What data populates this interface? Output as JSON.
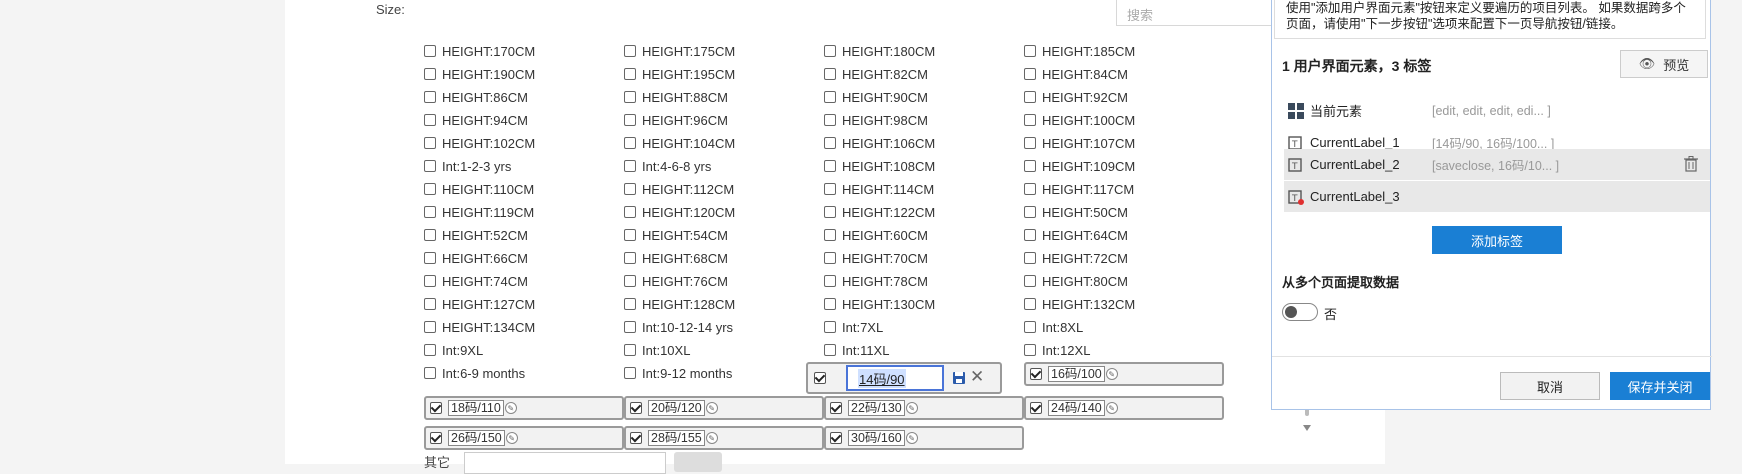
{
  "form": {
    "size_label": "Size:",
    "search_placeholder": "搜索",
    "options": [
      {
        "label": "HEIGHT:170CM",
        "checked": false
      },
      {
        "label": "HEIGHT:175CM",
        "checked": false
      },
      {
        "label": "HEIGHT:180CM",
        "checked": false
      },
      {
        "label": "HEIGHT:185CM",
        "checked": false
      },
      {
        "label": "HEIGHT:190CM",
        "checked": false
      },
      {
        "label": "HEIGHT:195CM",
        "checked": false
      },
      {
        "label": "HEIGHT:82CM",
        "checked": false
      },
      {
        "label": "HEIGHT:84CM",
        "checked": false
      },
      {
        "label": "HEIGHT:86CM",
        "checked": false
      },
      {
        "label": "HEIGHT:88CM",
        "checked": false
      },
      {
        "label": "HEIGHT:90CM",
        "checked": false
      },
      {
        "label": "HEIGHT:92CM",
        "checked": false
      },
      {
        "label": "HEIGHT:94CM",
        "checked": false
      },
      {
        "label": "HEIGHT:96CM",
        "checked": false
      },
      {
        "label": "HEIGHT:98CM",
        "checked": false
      },
      {
        "label": "HEIGHT:100CM",
        "checked": false
      },
      {
        "label": "HEIGHT:102CM",
        "checked": false
      },
      {
        "label": "HEIGHT:104CM",
        "checked": false
      },
      {
        "label": "HEIGHT:106CM",
        "checked": false
      },
      {
        "label": "HEIGHT:107CM",
        "checked": false
      },
      {
        "label": "Int:1-2-3 yrs",
        "checked": false
      },
      {
        "label": "Int:4-6-8 yrs",
        "checked": false
      },
      {
        "label": "HEIGHT:108CM",
        "checked": false
      },
      {
        "label": "HEIGHT:109CM",
        "checked": false
      },
      {
        "label": "HEIGHT:110CM",
        "checked": false
      },
      {
        "label": "HEIGHT:112CM",
        "checked": false
      },
      {
        "label": "HEIGHT:114CM",
        "checked": false
      },
      {
        "label": "HEIGHT:117CM",
        "checked": false
      },
      {
        "label": "HEIGHT:119CM",
        "checked": false
      },
      {
        "label": "HEIGHT:120CM",
        "checked": false
      },
      {
        "label": "HEIGHT:122CM",
        "checked": false
      },
      {
        "label": "HEIGHT:50CM",
        "checked": false
      },
      {
        "label": "HEIGHT:52CM",
        "checked": false
      },
      {
        "label": "HEIGHT:54CM",
        "checked": false
      },
      {
        "label": "HEIGHT:60CM",
        "checked": false
      },
      {
        "label": "HEIGHT:64CM",
        "checked": false
      },
      {
        "label": "HEIGHT:66CM",
        "checked": false
      },
      {
        "label": "HEIGHT:68CM",
        "checked": false
      },
      {
        "label": "HEIGHT:70CM",
        "checked": false
      },
      {
        "label": "HEIGHT:72CM",
        "checked": false
      },
      {
        "label": "HEIGHT:74CM",
        "checked": false
      },
      {
        "label": "HEIGHT:76CM",
        "checked": false
      },
      {
        "label": "HEIGHT:78CM",
        "checked": false
      },
      {
        "label": "HEIGHT:80CM",
        "checked": false
      },
      {
        "label": "HEIGHT:127CM",
        "checked": false
      },
      {
        "label": "HEIGHT:128CM",
        "checked": false
      },
      {
        "label": "HEIGHT:130CM",
        "checked": false
      },
      {
        "label": "HEIGHT:132CM",
        "checked": false
      },
      {
        "label": "HEIGHT:134CM",
        "checked": false
      },
      {
        "label": "Int:10-12-14 yrs",
        "checked": false
      },
      {
        "label": "Int:7XL",
        "checked": false
      },
      {
        "label": "Int:8XL",
        "checked": false
      },
      {
        "label": "Int:9XL",
        "checked": false
      },
      {
        "label": "Int:10XL",
        "checked": false
      },
      {
        "label": "Int:11XL",
        "checked": false
      },
      {
        "label": "Int:12XL",
        "checked": false
      },
      {
        "label": "Int:6-9 months",
        "checked": false
      },
      {
        "label": "Int:9-12 months",
        "checked": false
      }
    ],
    "editing_value": "14码/90",
    "tags": [
      "16码/100",
      "18码/110",
      "20码/120",
      "22码/130",
      "24码/140",
      "26码/150",
      "28码/155",
      "30码/160"
    ],
    "below_label": "其它"
  },
  "panel": {
    "notice": "使用\"添加用户界面元素\"按钮来定义要遍历的项目列表。 如果数据跨多个页面，请使用\"下一步按钮\"选项来配置下一页导航按钮/链接。",
    "summary": "1 用户界面元素，3 标签",
    "preview_label": "预览",
    "rows": [
      {
        "name": "当前元素",
        "value": "[edit, edit, edit, edi... ]",
        "icon": "grid-icon"
      },
      {
        "name": "CurrentLabel_1",
        "value": "[14码/90, 16码/100... ]",
        "icon": "label-icon"
      },
      {
        "name": "CurrentLabel_2",
        "value": "[saveclose, 16码/10... ]",
        "icon": "label-icon"
      },
      {
        "name": "CurrentLabel_3",
        "value": "",
        "icon": "label-error-icon"
      }
    ],
    "add_label_button": "添加标签",
    "multi_page_label": "从多个页面提取数据",
    "multi_page_value": "否",
    "cancel_label": "取消",
    "save_close_label": "保存并关闭"
  },
  "colors": {
    "accent": "#1a7fd4",
    "selection": "#e8e8e8",
    "edit_border": "#4a74d8"
  }
}
